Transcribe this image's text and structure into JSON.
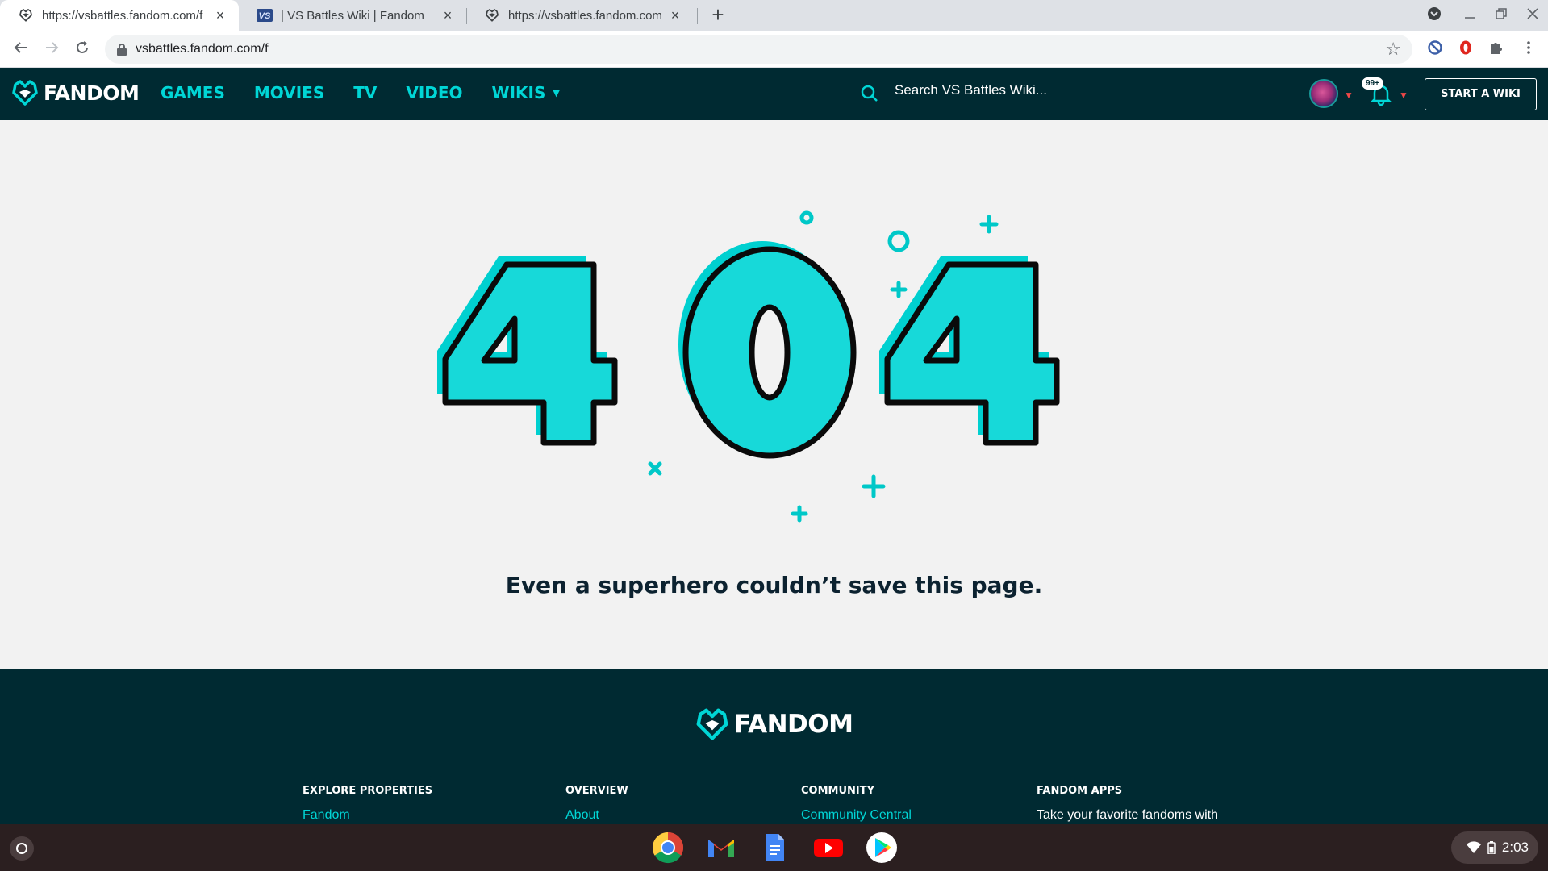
{
  "browser": {
    "tabs": [
      {
        "title": "https://vsbattles.fandom.com/f",
        "icon": "fandom-heart-icon",
        "active": true
      },
      {
        "title": "| VS Battles Wiki | Fandom",
        "icon": "vs-logo-icon",
        "active": false
      },
      {
        "title": "https://vsbattles.fandom.com/f/",
        "icon": "fandom-heart-icon",
        "active": false
      }
    ],
    "url": "vsbattles.fandom.com/f"
  },
  "nav": {
    "logo": "FANDOM",
    "links": [
      "GAMES",
      "MOVIES",
      "TV",
      "VIDEO",
      "WIKIS"
    ],
    "search_placeholder": "Search VS Battles Wiki...",
    "notifications_badge": "99+",
    "start_wiki": "START A WIKI"
  },
  "error": {
    "code": "404",
    "message": "Even a superhero couldn’t save this page."
  },
  "footer": {
    "logo": "FANDOM",
    "columns": [
      {
        "heading": "EXPLORE PROPERTIES",
        "item": "Fandom"
      },
      {
        "heading": "OVERVIEW",
        "item": "About"
      },
      {
        "heading": "COMMUNITY",
        "item": "Community Central"
      },
      {
        "heading": "FANDOM APPS",
        "item": "Take your favorite fandoms with"
      }
    ]
  },
  "shelf": {
    "apps": [
      "chrome",
      "gmail",
      "docs",
      "youtube",
      "play-store"
    ],
    "time": "2:03"
  },
  "colors": {
    "fandom_dark": "#002a32",
    "fandom_teal": "#00d6d6",
    "content_bg": "#f2f2f2",
    "accent_red": "#f04848"
  }
}
